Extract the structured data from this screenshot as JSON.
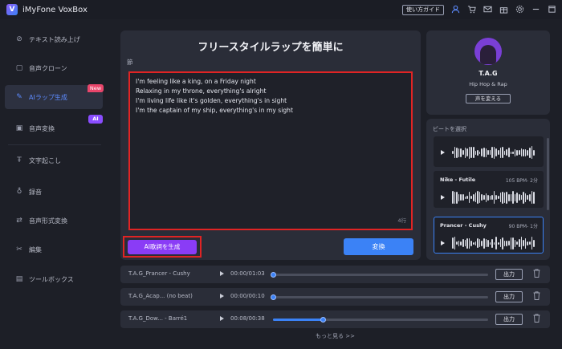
{
  "app": {
    "title": "iMyFone VoxBox",
    "logo_letter": "V",
    "guide": "使い方ガイド"
  },
  "titlebar_icons": [
    "user-icon",
    "cart-icon",
    "mail-icon",
    "gift-icon",
    "settings-icon",
    "minimize-icon",
    "maximize-icon",
    "close-icon"
  ],
  "sidebar": {
    "items": [
      {
        "label": "テキスト読み上げ",
        "icon": "text-to-speech-icon"
      },
      {
        "label": "音声クローン",
        "icon": "voice-clone-icon"
      },
      {
        "label": "AIラップ生成",
        "icon": "ai-rap-icon",
        "active": true,
        "badge": "New"
      },
      {
        "label": "音声変換",
        "icon": "voice-convert-icon",
        "badge": "AI"
      },
      {
        "label": "文字起こし",
        "icon": "transcribe-icon"
      },
      {
        "label": "録音",
        "icon": "record-icon"
      },
      {
        "label": "音声形式変換",
        "icon": "format-convert-icon"
      },
      {
        "label": "編集",
        "icon": "edit-icon"
      },
      {
        "label": "ツールボックス",
        "icon": "toolbox-icon"
      }
    ]
  },
  "main": {
    "title": "フリースタイルラップを簡単に",
    "section_label": "節",
    "lyrics": [
      "I'm feeling like a king, on a Friday night",
      "Relaxing in my throne, everything's alright",
      "I'm living life like it's golden, everything's in sight",
      "I'm the captain of my ship, everything's in my sight"
    ],
    "line_count": "4行",
    "generate_button": "AI歌詞を生成",
    "convert_button": "変換"
  },
  "artist": {
    "name": "T.A.G",
    "genre": "Hip Hop & Rap",
    "change_voice": "声を変える"
  },
  "beats": {
    "label": "ビートを選択",
    "items": [
      {
        "name": "",
        "bpm": "",
        "selected": false
      },
      {
        "name": "Nike - Futile",
        "bpm": "105 BPM- 2分",
        "selected": false
      },
      {
        "name": "Prancer - Cushy",
        "bpm": "90 BPM- 1分",
        "selected": true
      }
    ]
  },
  "tracks": [
    {
      "name": "T.A.G_Prancer - Cushy",
      "time": "00:00/01:03",
      "progress": 0.0,
      "output": "出力"
    },
    {
      "name": "T.A.G_Acap... (no beat)",
      "time": "00:00/00:10",
      "progress": 0.0,
      "output": "出力"
    },
    {
      "name": "T.A.G_Dow... - Barré1",
      "time": "00:08/00:38",
      "progress": 0.23,
      "output": "出力"
    }
  ],
  "more_link": "もっと見る >>",
  "colors": {
    "accent": "#3b82f6",
    "purple": "#8a3cf6",
    "highlight": "#e02424",
    "new_badge": "#e9466b"
  }
}
